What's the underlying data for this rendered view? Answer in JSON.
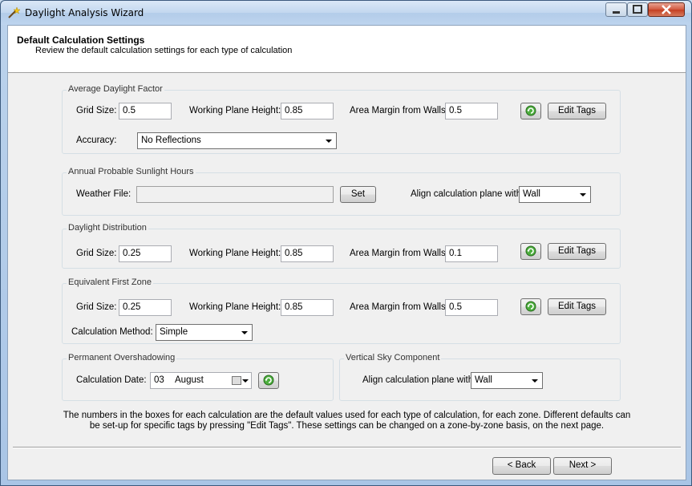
{
  "window": {
    "title": "Daylight Analysis Wizard"
  },
  "header": {
    "title": "Default Calculation Settings",
    "subtitle": "Review the default calculation settings for each type of calculation"
  },
  "labels": {
    "grid_size": "Grid Size:",
    "working_plane_height": "Working Plane Height:",
    "area_margin": "Area Margin from Walls:",
    "edit_tags": "Edit Tags",
    "accuracy": "Accuracy:",
    "weather_file": "Weather File:",
    "set": "Set",
    "align_plane": "Align calculation plane with:",
    "calc_method": "Calculation Method:",
    "calc_date": "Calculation Date:"
  },
  "adf": {
    "title": "Average Daylight Factor",
    "grid_size": "0.5",
    "working_plane_height": "0.85",
    "area_margin": "0.5",
    "accuracy": "No Reflections"
  },
  "apsh": {
    "title": "Annual Probable Sunlight Hours",
    "weather_file": "",
    "align": "Wall"
  },
  "dd": {
    "title": "Daylight Distribution",
    "grid_size": "0.25",
    "working_plane_height": "0.85",
    "area_margin": "0.1"
  },
  "efz": {
    "title": "Equivalent First Zone",
    "grid_size": "0.25",
    "working_plane_height": "0.85",
    "area_margin": "0.5",
    "method": "Simple"
  },
  "po": {
    "title": "Permanent Overshadowing",
    "date_day": "03",
    "date_month": "August"
  },
  "vsc": {
    "title": "Vertical Sky Component",
    "align": "Wall"
  },
  "info": {
    "line1": "The numbers in the boxes for each calculation are the default values used for each type of calculation, for each zone. Different defaults can",
    "line2": "be set-up for specific tags by pressing \"Edit Tags\".  These settings can be changed on a zone-by-zone basis, on the next page."
  },
  "footer": {
    "back": "< Back",
    "next": "Next >"
  },
  "icons": {
    "refresh": "refresh-icon",
    "app": "wand-icon"
  }
}
